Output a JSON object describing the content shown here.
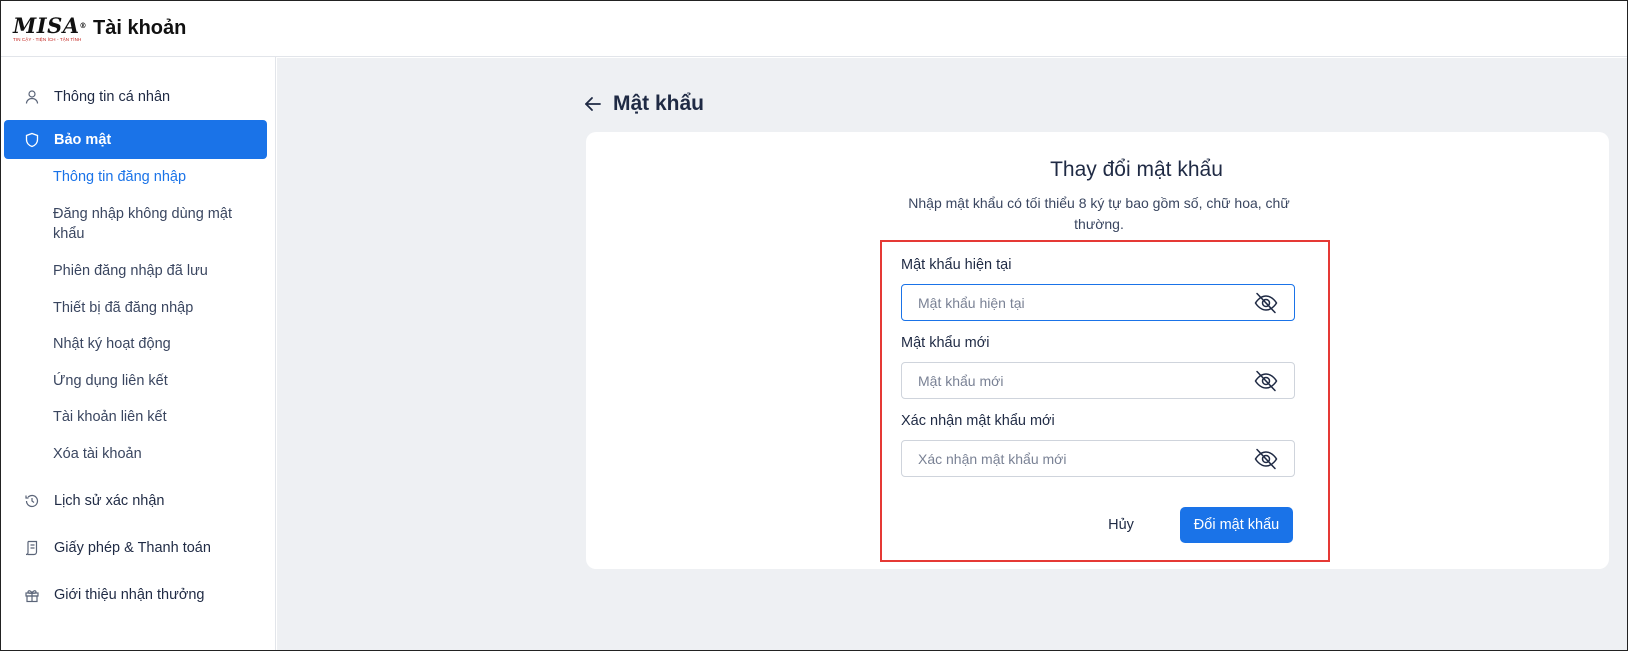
{
  "header": {
    "logo_text": "MISA",
    "logo_registered": "®",
    "logo_tagline": "TIN CẬY - TIỆN ÍCH - TẬN TÌNH",
    "app_title": "Tài khoản"
  },
  "sidebar": {
    "items": [
      {
        "label": "Thông tin cá nhân",
        "icon": "user-icon"
      },
      {
        "label": "Bảo mật",
        "icon": "shield-icon",
        "active": true
      },
      {
        "label": "Lịch sử xác nhận",
        "icon": "history-icon"
      },
      {
        "label": "Giấy phép & Thanh toán",
        "icon": "receipt-icon"
      },
      {
        "label": "Giới thiệu nhận thưởng",
        "icon": "gift-icon"
      }
    ],
    "security_subitems": [
      {
        "label": "Thông tin đăng nhập",
        "active": true
      },
      {
        "label": "Đăng nhập không dùng mật khẩu"
      },
      {
        "label": "Phiên đăng nhập đã lưu"
      },
      {
        "label": "Thiết bị đã đăng nhập"
      },
      {
        "label": "Nhật ký hoạt động"
      },
      {
        "label": "Ứng dụng liên kết"
      },
      {
        "label": "Tài khoản liên kết"
      },
      {
        "label": "Xóa tài khoản"
      }
    ]
  },
  "main": {
    "page_title": "Mật khẩu",
    "card": {
      "title": "Thay đổi mật khẩu",
      "subtitle": "Nhập mật khẩu có tối thiểu 8 ký tự bao gồm số, chữ hoa, chữ thường.",
      "fields": [
        {
          "label": "Mật khẩu hiện tại",
          "placeholder": "Mật khẩu hiện tại",
          "value": ""
        },
        {
          "label": "Mật khẩu mới",
          "placeholder": "Mật khẩu mới",
          "value": ""
        },
        {
          "label": "Xác nhận mật khẩu mới",
          "placeholder": "Xác nhận mật khẩu mới",
          "value": ""
        }
      ],
      "cancel_label": "Hủy",
      "submit_label": "Đổi mật khẩu"
    }
  },
  "colors": {
    "accent": "#1a73e8",
    "highlight_border": "#e53935",
    "background": "#eef0f3"
  }
}
